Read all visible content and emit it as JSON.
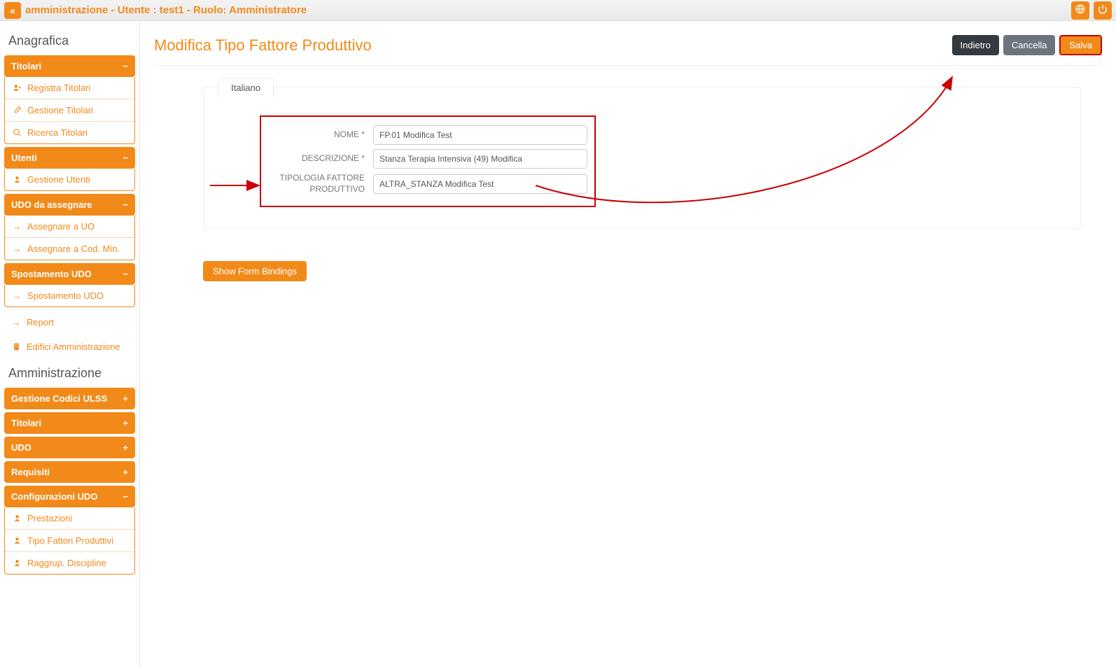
{
  "topbar": {
    "title": "amministrazione - Utente : test1 - Ruolo: Amministratore"
  },
  "sidebar": {
    "section_anagrafica": "Anagrafica",
    "section_amministrazione": "Amministrazione",
    "titolari": {
      "header": "Titolari",
      "items": [
        {
          "label": "Registra Titolari",
          "icon": "user-plus"
        },
        {
          "label": "Gestione Titolari",
          "icon": "edit"
        },
        {
          "label": "Ricerca Titolari",
          "icon": "search"
        }
      ]
    },
    "utenti": {
      "header": "Utenti",
      "items": [
        {
          "label": "Gestione Utenti",
          "icon": "user"
        }
      ]
    },
    "udo_assegnare": {
      "header": "UDO da assegnare",
      "items": [
        {
          "label": "Assegnare a UO",
          "icon": "arrow-right"
        },
        {
          "label": "Assegnare a Cod. Min.",
          "icon": "arrow-right"
        }
      ]
    },
    "spostamento": {
      "header": "Spostamento UDO",
      "items": [
        {
          "label": "Spostamento UDO",
          "icon": "arrow-right"
        }
      ]
    },
    "standalone": [
      {
        "label": "Report",
        "icon": "arrow-right"
      },
      {
        "label": "Edifici Amministrazione",
        "icon": "building"
      }
    ],
    "gestione_codici": {
      "header": "Gestione Codici ULSS"
    },
    "titolari2": {
      "header": "Titolari"
    },
    "udo": {
      "header": "UDO"
    },
    "requisiti": {
      "header": "Requisiti"
    },
    "config_udo": {
      "header": "Configurazioni UDO",
      "items": [
        {
          "label": "Prestazioni",
          "icon": "user"
        },
        {
          "label": "Tipo Fattori Produttivi",
          "icon": "user"
        },
        {
          "label": "Raggrup. Discipline",
          "icon": "user"
        }
      ]
    }
  },
  "main": {
    "title": "Modifica Tipo Fattore Produttivo",
    "buttons": {
      "back": "Indietro",
      "cancel": "Cancella",
      "save": "Salva"
    },
    "tab": "Italiano",
    "form": {
      "nome_label": "NOME *",
      "nome_value": "FP.01 Modifica Test",
      "descrizione_label": "DESCRIZIONE *",
      "descrizione_value": "Stanza Terapia Intensiva (49) Modifica",
      "tipologia_label": "TIPOLOGIA FATTORE PRODUTTIVO",
      "tipologia_value": "ALTRA_STANZA Modifica Test"
    },
    "show_bindings": "Show Form Bindings"
  }
}
